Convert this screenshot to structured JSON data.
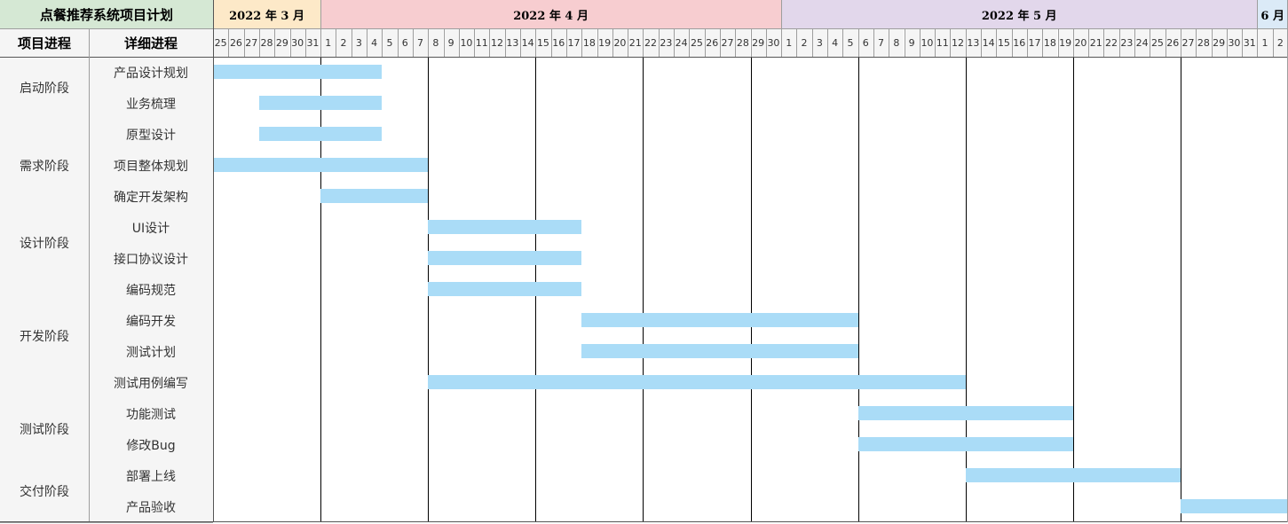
{
  "title": "点餐推荐系统项目计划",
  "header": {
    "phase_col": "项目进程",
    "task_col": "详细进程"
  },
  "months": [
    {
      "label": "2022 年 3 月",
      "color": "#fde9c8",
      "days": [
        25,
        26,
        27,
        28,
        29,
        30,
        31
      ]
    },
    {
      "label": "2022 年 4 月",
      "color": "#f7cdd0",
      "days": [
        1,
        2,
        3,
        4,
        5,
        6,
        7,
        8,
        9,
        10,
        11,
        12,
        13,
        14,
        15,
        16,
        17,
        18,
        19,
        20,
        21,
        22,
        23,
        24,
        25,
        26,
        27,
        28,
        29,
        30
      ]
    },
    {
      "label": "2022 年 5 月",
      "color": "#e2d7eb",
      "days": [
        1,
        2,
        3,
        4,
        5,
        6,
        7,
        8,
        9,
        10,
        11,
        12,
        13,
        14,
        15,
        16,
        17,
        18,
        19,
        20,
        21,
        22,
        23,
        24,
        25,
        26,
        27,
        28,
        29,
        30,
        31
      ]
    },
    {
      "label": "6 月",
      "color": "#dbeaf7",
      "days": [
        1,
        2
      ]
    }
  ],
  "colors": {
    "title_bg": "#d5e8d4",
    "bar": "#aadcf7",
    "header_bg": "#f5f5f5",
    "grid": "#9e9e9e",
    "week_line": "#000000"
  },
  "phases": [
    {
      "name": "启动阶段",
      "tasks": [
        {
          "name": "产品设计规划",
          "start": "2022-03-25",
          "end": "2022-04-04"
        },
        {
          "name": "业务梳理",
          "start": "2022-03-28",
          "end": "2022-04-04"
        }
      ]
    },
    {
      "name": "需求阶段",
      "tasks": [
        {
          "name": "原型设计",
          "start": "2022-03-28",
          "end": "2022-04-04"
        },
        {
          "name": "项目整体规划",
          "start": "2022-03-25",
          "end": "2022-04-07"
        },
        {
          "name": "确定开发架构",
          "start": "2022-04-01",
          "end": "2022-04-07"
        }
      ]
    },
    {
      "name": "设计阶段",
      "tasks": [
        {
          "name": "UI设计",
          "start": "2022-04-08",
          "end": "2022-04-17"
        },
        {
          "name": "接口协议设计",
          "start": "2022-04-08",
          "end": "2022-04-17"
        }
      ]
    },
    {
      "name": "开发阶段",
      "tasks": [
        {
          "name": "编码规范",
          "start": "2022-04-08",
          "end": "2022-04-17"
        },
        {
          "name": "编码开发",
          "start": "2022-04-18",
          "end": "2022-05-05"
        },
        {
          "name": "测试计划",
          "start": "2022-04-18",
          "end": "2022-05-05"
        },
        {
          "name": "测试用例编写",
          "start": "2022-04-08",
          "end": "2022-05-12"
        }
      ]
    },
    {
      "name": "测试阶段",
      "tasks": [
        {
          "name": "功能测试",
          "start": "2022-05-06",
          "end": "2022-05-19"
        },
        {
          "name": "修改Bug",
          "start": "2022-05-06",
          "end": "2022-05-19"
        }
      ]
    },
    {
      "name": "交付阶段",
      "tasks": [
        {
          "name": "部署上线",
          "start": "2022-05-13",
          "end": "2022-05-26"
        },
        {
          "name": "产品验收",
          "start": "2022-05-27",
          "end": "2022-06-02"
        }
      ]
    }
  ]
}
